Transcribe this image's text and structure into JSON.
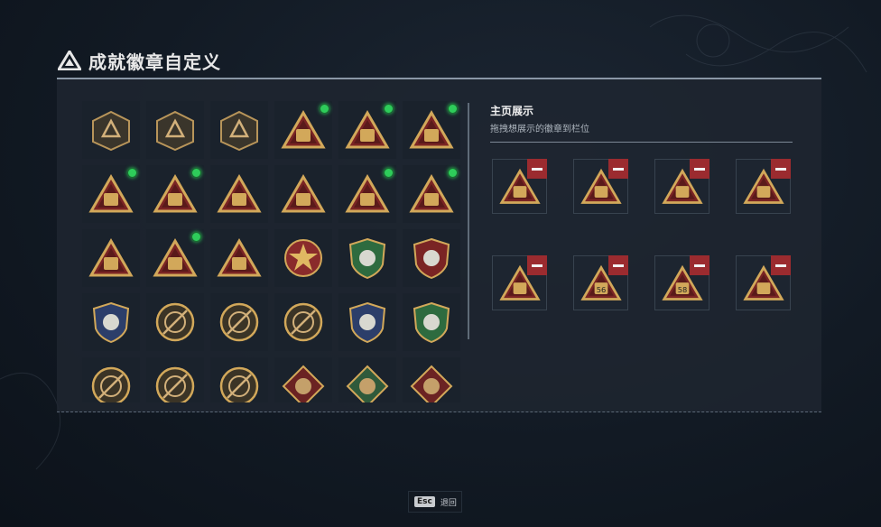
{
  "page": {
    "title": "成就徽章自定义"
  },
  "showcase": {
    "title": "主页展示",
    "hint": "拖拽想展示的徽章到栏位"
  },
  "footer": {
    "key": "Esc",
    "label": "退回"
  },
  "colors": {
    "accent_green": "#2ecc5a",
    "remove_red": "#9b2b2f",
    "gold": "#d2a85a",
    "maroon": "#7a2424"
  },
  "badges": [
    {
      "icon": "delta-emblem-icon",
      "new": false
    },
    {
      "icon": "helicopter-emblem-icon",
      "new": false
    },
    {
      "icon": "jet-emblem-icon",
      "new": false
    },
    {
      "icon": "backpack-badge-icon",
      "new": true
    },
    {
      "icon": "number-56-badge-icon",
      "new": true
    },
    {
      "icon": "figure-badge-icon",
      "new": true
    },
    {
      "icon": "id-card-58-badge-icon",
      "new": true
    },
    {
      "icon": "soldier-badge-icon",
      "new": true
    },
    {
      "icon": "treasure-badge-icon",
      "new": false
    },
    {
      "icon": "number-1-badge-icon",
      "new": false
    },
    {
      "icon": "bottle-badge-icon",
      "new": true
    },
    {
      "icon": "kneeling-figure-badge-icon",
      "new": true
    },
    {
      "icon": "squad-badge-icon",
      "new": false
    },
    {
      "icon": "rocket-badge-icon",
      "new": true
    },
    {
      "icon": "crystal-badge-icon",
      "new": false
    },
    {
      "icon": "star-medal-icon",
      "new": false
    },
    {
      "icon": "green-shield-icon",
      "new": false
    },
    {
      "icon": "stars-shield-icon",
      "new": false
    },
    {
      "icon": "skull-shield-icon",
      "new": false
    },
    {
      "icon": "crosshair-skull-icon",
      "new": false
    },
    {
      "icon": "knife-round-icon",
      "new": false
    },
    {
      "icon": "mask-round-icon",
      "new": false
    },
    {
      "icon": "rifle-blue-shield-icon",
      "new": false
    },
    {
      "icon": "rifle-green-shield-icon",
      "new": false
    },
    {
      "icon": "gun-round-icon",
      "new": false
    },
    {
      "icon": "gun-round-2-icon",
      "new": false
    },
    {
      "icon": "crossed-rifles-icon",
      "new": false
    },
    {
      "icon": "beast-diamond-icon",
      "new": false
    },
    {
      "icon": "eagle-hex-icon",
      "new": false
    },
    {
      "icon": "dragon-diamond-icon",
      "new": false
    }
  ],
  "slots": [
    {
      "icon": "bottle-badge-icon"
    },
    {
      "icon": "kneeling-figure-badge-icon"
    },
    {
      "icon": "soldier-badge-icon"
    },
    {
      "icon": "figure-badge-icon"
    },
    {
      "icon": "backpack-badge-icon"
    },
    {
      "icon": "number-56-badge-icon",
      "text": "56"
    },
    {
      "icon": "id-card-58-badge-icon",
      "text": "58"
    },
    {
      "icon": "rocket-badge-icon"
    }
  ]
}
